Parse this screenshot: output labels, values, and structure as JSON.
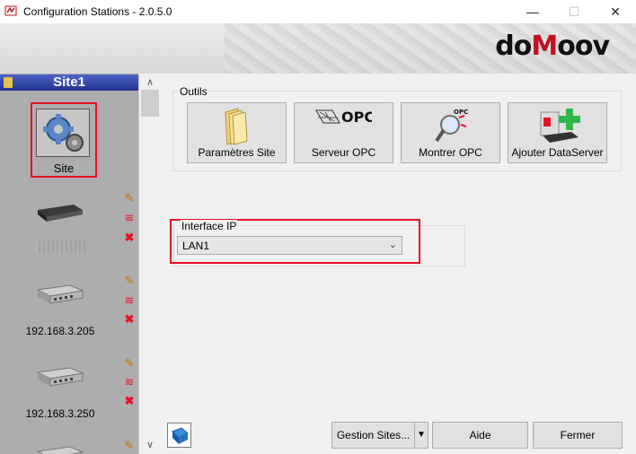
{
  "window": {
    "title": "Configuration Stations - 2.0.5.0",
    "controls": {
      "minimize": "—",
      "maximize": "☐",
      "close": "✕"
    }
  },
  "banner": {
    "logo_text": "doMoov",
    "logo_color": "#c0121f"
  },
  "sidebar": {
    "header": "Site1",
    "selected_item": {
      "label": "Site",
      "icon": "gears-icon"
    },
    "devices": [
      {
        "label": "",
        "icon": "server-box-icon",
        "actions": [
          "edit-icon",
          "wifi-icon",
          "delete-icon"
        ]
      },
      {
        "label": "192.168.3.205",
        "icon": "server-box-icon",
        "actions": [
          "edit-icon",
          "wifi-icon",
          "delete-icon"
        ]
      },
      {
        "label": "192.168.3.250",
        "icon": "server-box-icon",
        "actions": [
          "edit-icon",
          "wifi-icon",
          "delete-icon"
        ]
      }
    ],
    "scroll": {
      "up": "∧",
      "down": "∨"
    }
  },
  "tools": {
    "group_label": "Outils",
    "buttons": [
      {
        "label": "Paramètres Site",
        "icon": "folder-icon"
      },
      {
        "label": "Serveur OPC",
        "icon": "opc-logo-icon"
      },
      {
        "label": "Montrer OPC",
        "icon": "magnifier-icon"
      },
      {
        "label": "Ajouter DataServer",
        "icon": "add-server-icon"
      }
    ],
    "opc_text": "OPC"
  },
  "interface": {
    "group_label": "Interface IP",
    "selected": "LAN1"
  },
  "footer": {
    "gestion_label": "Gestion Sites...",
    "dropdown_arrow": "▼",
    "aide_label": "Aide",
    "fermer_label": "Fermer"
  },
  "colors": {
    "highlight_red": "#e81123",
    "header_blue": "#2a3d9e"
  }
}
